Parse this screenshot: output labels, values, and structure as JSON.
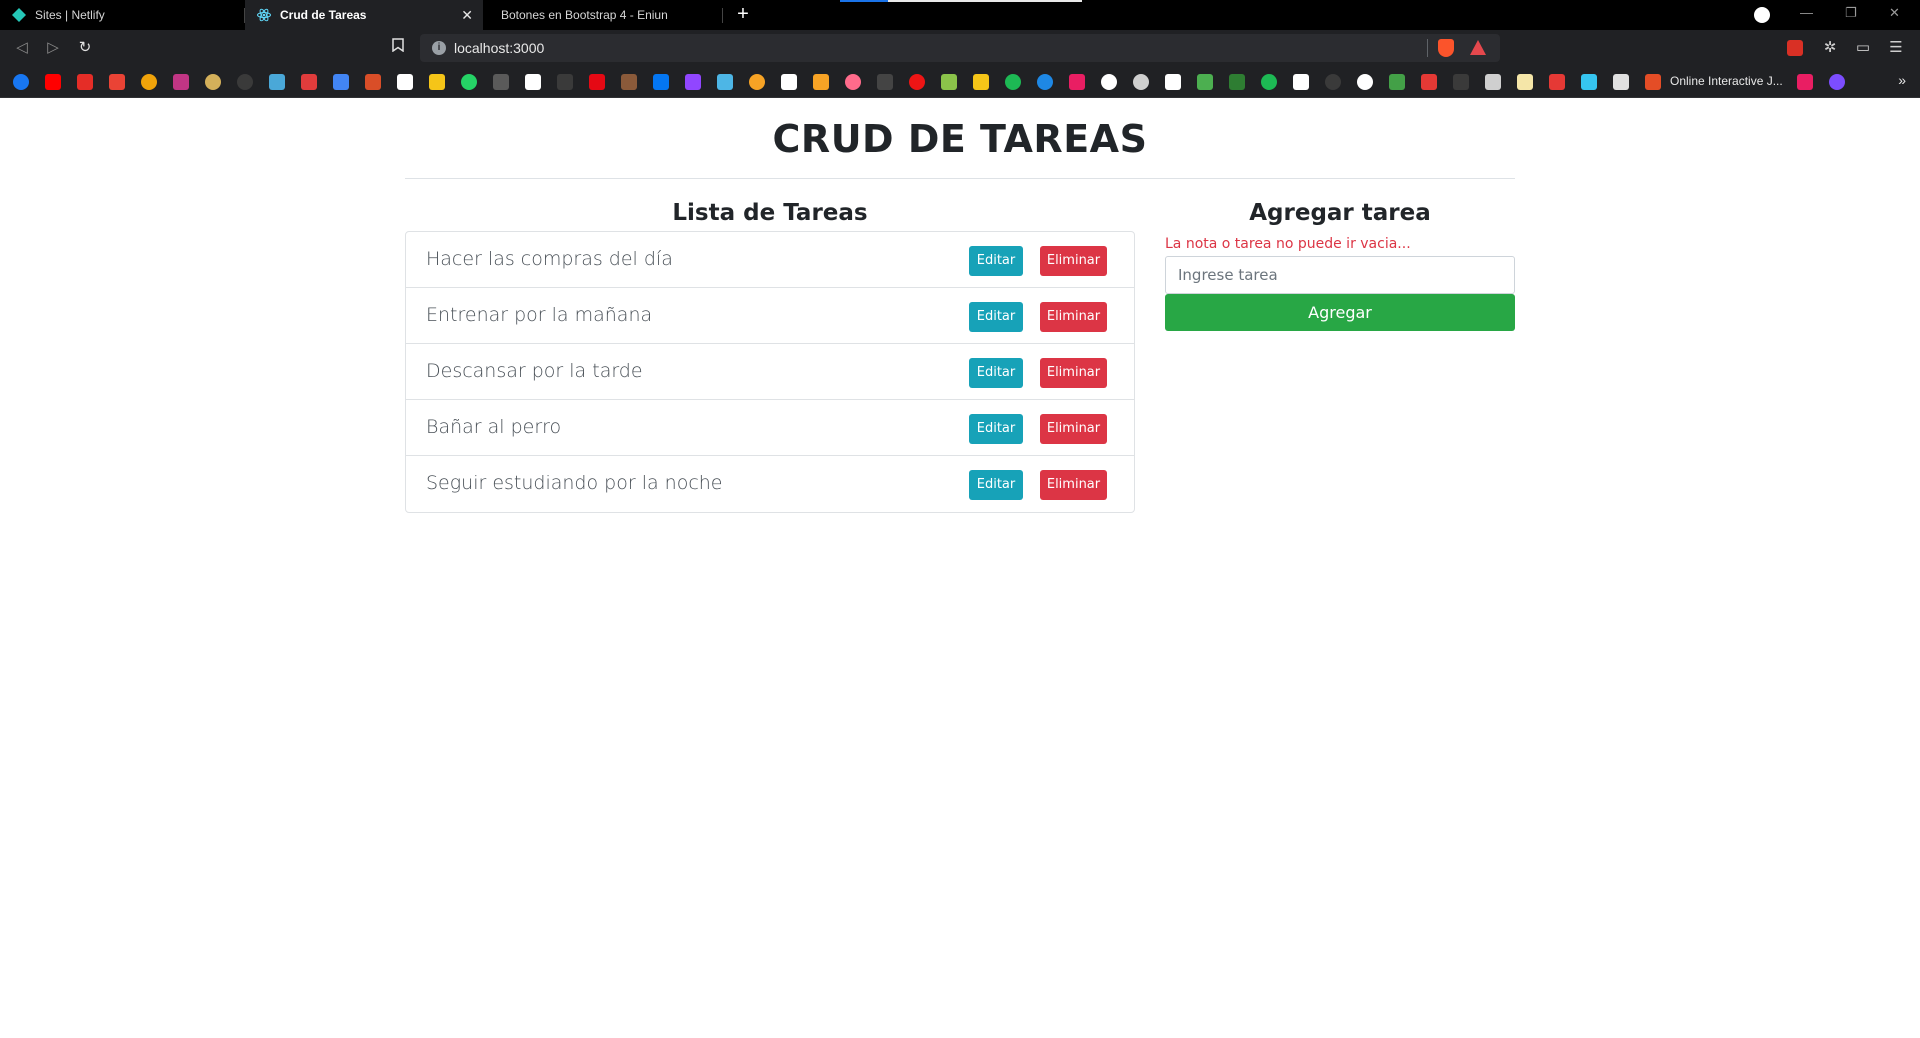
{
  "browser": {
    "tabs": [
      {
        "title": "Sites | Netlify",
        "active": false
      },
      {
        "title": "Crud de Tareas",
        "active": true
      },
      {
        "title": "Botones en Bootstrap 4 - Eniun",
        "active": false
      }
    ],
    "url": "localhost:3000",
    "bookmark_folder_label": "Online Interactive J...",
    "more_bookmarks": "»"
  },
  "page": {
    "title": "CRUD DE TAREAS",
    "list_heading": "Lista de Tareas",
    "form_heading": "Agregar tarea",
    "tasks": [
      "Hacer las compras del día",
      "Entrenar por la mañana",
      "Descansar por la tarde",
      "Bañar al perro",
      "Seguir estudiando por la noche"
    ],
    "edit_label": "Editar",
    "delete_label": "Eliminar",
    "error_message": "La nota o tarea no puede ir vacia...",
    "input_placeholder": "Ingrese tarea",
    "add_label": "Agregar"
  },
  "colors": {
    "edit_button": "#17a2b8",
    "delete_button": "#dc3545",
    "add_button": "#28a745",
    "error_text": "#dc3545"
  }
}
